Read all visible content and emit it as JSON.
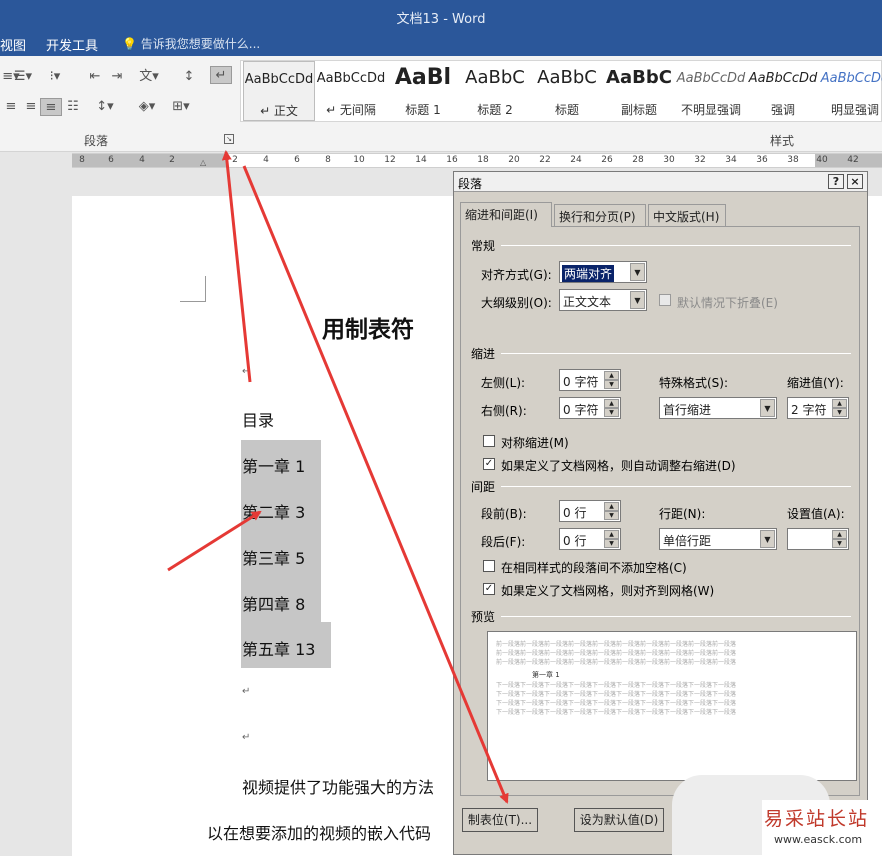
{
  "window": {
    "title": "文档13 - Word"
  },
  "ribbon_tabs": {
    "view": "视图",
    "developer": "开发工具",
    "tell_me": "告诉我您想要做什么..."
  },
  "ribbon": {
    "paragraph_group": "段落",
    "styles_group": "样式",
    "styles": [
      {
        "sample": "AaBbCcDd",
        "name": "↵ 正文"
      },
      {
        "sample": "AaBbCcDd",
        "name": "↵ 无间隔"
      },
      {
        "sample": "AaBl",
        "name": "标题 1"
      },
      {
        "sample": "AaBbC",
        "name": "标题 2"
      },
      {
        "sample": "AaBbC",
        "name": "标题"
      },
      {
        "sample": "AaBbC",
        "name": "副标题"
      },
      {
        "sample": "AaBbCcDd",
        "name": "不明显强调"
      },
      {
        "sample": "AaBbCcDd",
        "name": "强调"
      },
      {
        "sample": "AaBbCcDd",
        "name": "明显强调"
      }
    ]
  },
  "ruler": {
    "left_numbers": [
      "8",
      "6",
      "4",
      "2"
    ],
    "right_numbers": [
      "2",
      "4",
      "6",
      "8",
      "10",
      "12",
      "14",
      "16",
      "18",
      "20",
      "22",
      "24",
      "26",
      "28",
      "30",
      "32",
      "34",
      "36",
      "38",
      "40",
      "42"
    ]
  },
  "document": {
    "title": "用制表符",
    "toc_heading": "目录",
    "toc_items": [
      "第一章 1",
      "第二章 3",
      "第三章 5",
      "第四章 8",
      "第五章 13"
    ],
    "body_line1": "视频提供了功能强大的方法",
    "body_line2": "以在想要添加的视频的嵌入代码"
  },
  "dialog": {
    "title": "段落",
    "help": "?",
    "close": "×",
    "tabs": [
      "缩进和间距(I)",
      "换行和分页(P)",
      "中文版式(H)"
    ],
    "general": {
      "heading": "常规",
      "alignment_label": "对齐方式(G):",
      "alignment_value": "两端对齐",
      "outline_label": "大纲级别(O):",
      "outline_value": "正文文本",
      "collapse_label": "默认情况下折叠(E)"
    },
    "indent": {
      "heading": "缩进",
      "left_label": "左侧(L):",
      "left_value": "0 字符",
      "right_label": "右侧(R):",
      "right_value": "0 字符",
      "special_label": "特殊格式(S):",
      "special_value": "首行缩进",
      "by_label": "缩进值(Y):",
      "by_value": "2 字符",
      "mirror_label": "对称缩进(M)",
      "auto_adjust_label": "如果定义了文档网格，则自动调整右缩进(D)"
    },
    "spacing": {
      "heading": "间距",
      "before_label": "段前(B):",
      "before_value": "0 行",
      "after_label": "段后(F):",
      "after_value": "0 行",
      "line_label": "行距(N):",
      "line_value": "单倍行距",
      "at_label": "设置值(A):",
      "at_value": "",
      "no_space_label": "在相同样式的段落间不添加空格(C)",
      "snap_label": "如果定义了文档网格，则对齐到网格(W)"
    },
    "preview": {
      "heading": "预览",
      "prev_text": "前一段落前一段落前一段落前一段落前一段落前一段落前一段落前一段落前一段落前一段落",
      "sample_text": "第一章 1",
      "next_text": "下一段落下一段落下一段落下一段落下一段落下一段落下一段落下一段落下一段落下一段落"
    },
    "buttons": {
      "tabs": "制表位(T)...",
      "default": "设为默认值(D)"
    }
  },
  "watermark": {
    "line1": "易采站长站",
    "line2": "www.easck.com"
  },
  "colors": {
    "title_bar": "#2b579a",
    "arrow": "#e53935",
    "selection": "#c6c6c6",
    "dialog_bg": "#d4d0c8"
  }
}
